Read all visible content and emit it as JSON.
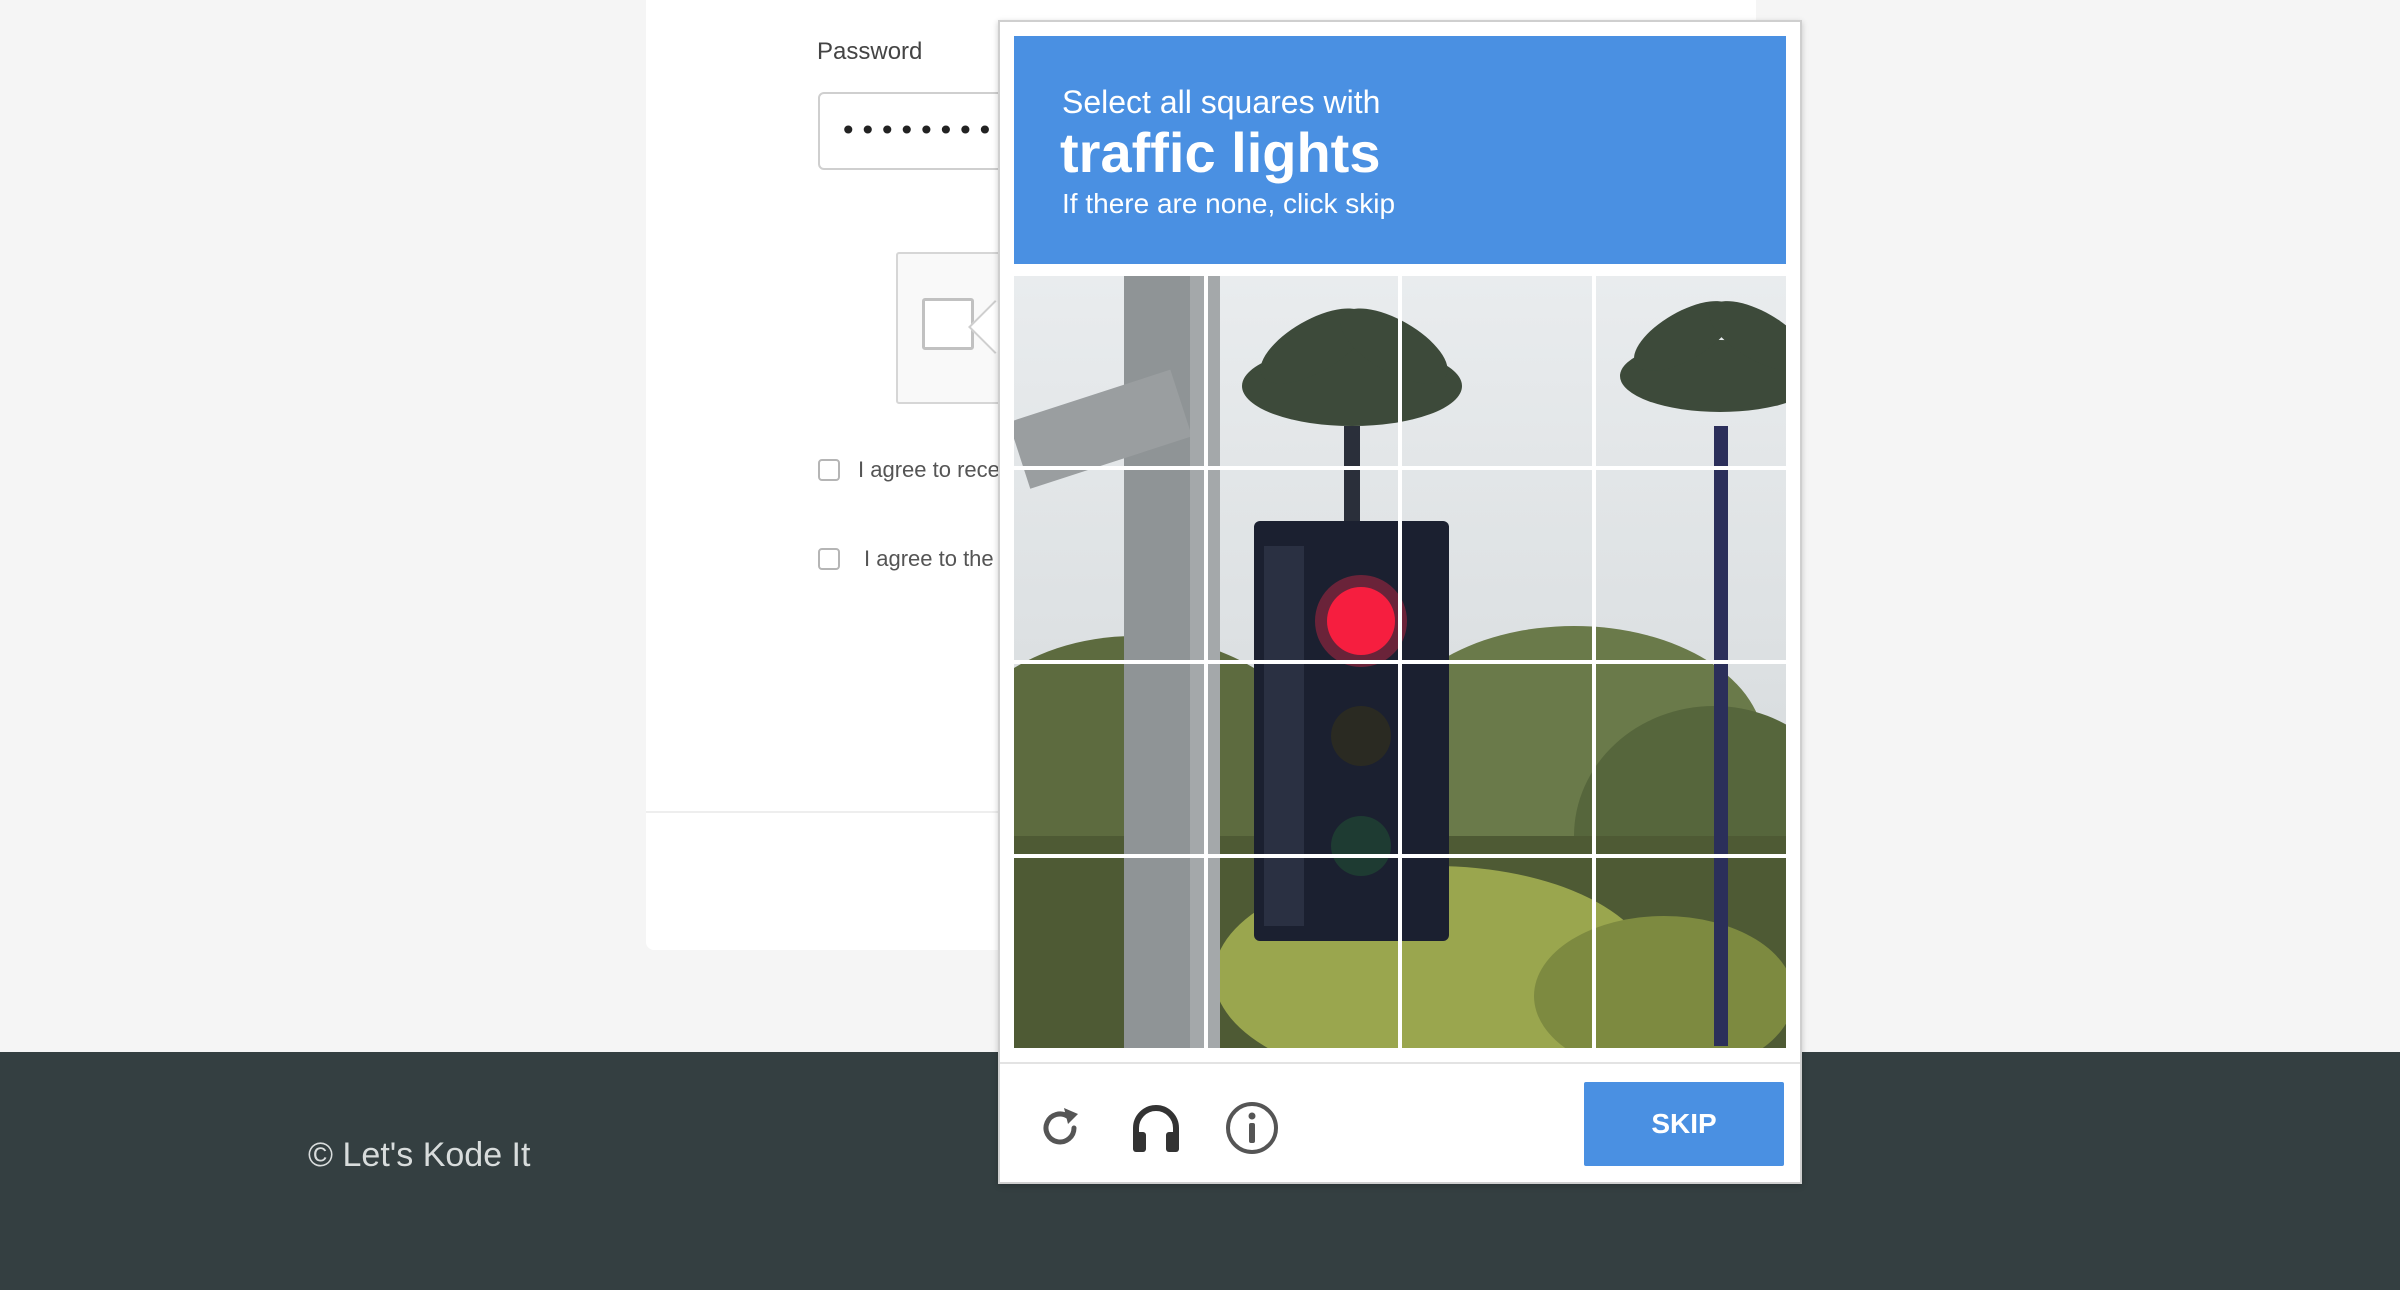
{
  "form": {
    "password_label": "Password",
    "password_value": "••••••••",
    "agree_1_text": "I agree to rece",
    "agree_2_text": "I agree to the"
  },
  "footer": {
    "copyright": "© Let's Kode It"
  },
  "captcha": {
    "instruction_line1": "Select all squares with",
    "target_object": "traffic lights",
    "instruction_line3": "If there are none, click skip",
    "skip_label": "SKIP",
    "tile_count": 16,
    "icons": [
      "reload-icon",
      "headphones-icon",
      "info-icon"
    ]
  },
  "colors": {
    "accent": "#4a90e2",
    "footer_bg": "#343f41",
    "page_bg": "#f5f5f5"
  }
}
